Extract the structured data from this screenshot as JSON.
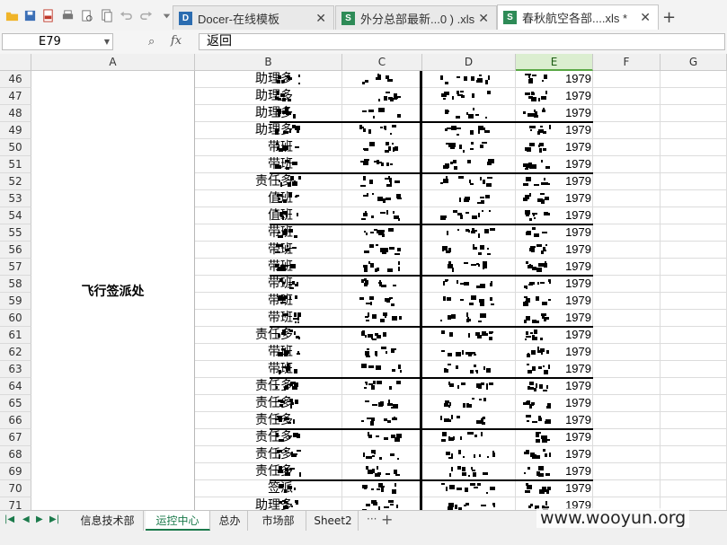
{
  "quick_access": [
    "open-folder-icon",
    "save-icon",
    "pdf-export-icon",
    "print-icon",
    "print-preview-icon",
    "copy-format-icon",
    "undo-icon",
    "redo-icon",
    "dropdown-icon"
  ],
  "tabs": [
    {
      "label": "Docer-在线模板",
      "icon": "D",
      "color": "#2b6cb0",
      "active": false
    },
    {
      "label": "外分总部最新...0 ) .xls",
      "icon": "S",
      "color": "#2e8b57",
      "active": false
    },
    {
      "label": "春秋航空各部....xls *",
      "icon": "S",
      "color": "#2e8b57",
      "active": true
    }
  ],
  "formula_bar": {
    "name_box": "E79",
    "content": "返回"
  },
  "columns": [
    {
      "label": "A"
    },
    {
      "label": "B"
    },
    {
      "label": "C"
    },
    {
      "label": "D"
    },
    {
      "label": "E",
      "selected": true
    },
    {
      "label": "F"
    },
    {
      "label": "G"
    }
  ],
  "merged_a_label": "飞行签派处",
  "rows": [
    {
      "n": "46",
      "b": "助理多",
      "e": "1979"
    },
    {
      "n": "47",
      "b": "助理多",
      "e": "1979"
    },
    {
      "n": "48",
      "b": "助理多",
      "e": "1979"
    },
    {
      "n": "49",
      "b": "助理多",
      "e": "1979"
    },
    {
      "n": "50",
      "b": "带班",
      "e": "1979"
    },
    {
      "n": "51",
      "b": "带班",
      "e": "1979"
    },
    {
      "n": "52",
      "b": "责任多",
      "e": "1979"
    },
    {
      "n": "53",
      "b": "值班",
      "e": "1979"
    },
    {
      "n": "54",
      "b": "值班",
      "e": "1979"
    },
    {
      "n": "55",
      "b": "带班",
      "e": "1979"
    },
    {
      "n": "56",
      "b": "带班",
      "e": "1979"
    },
    {
      "n": "57",
      "b": "带班",
      "e": "1979"
    },
    {
      "n": "58",
      "b": "带班",
      "e": "1979"
    },
    {
      "n": "59",
      "b": "带班",
      "e": "1979"
    },
    {
      "n": "60",
      "b": "带班",
      "e": "1979"
    },
    {
      "n": "61",
      "b": "责任多",
      "e": "1979"
    },
    {
      "n": "62",
      "b": "带班",
      "e": "1979"
    },
    {
      "n": "63",
      "b": "带班",
      "e": "1979"
    },
    {
      "n": "64",
      "b": "责任多",
      "e": "1979"
    },
    {
      "n": "65",
      "b": "责任多",
      "e": "1979"
    },
    {
      "n": "66",
      "b": "责任多",
      "e": "1979"
    },
    {
      "n": "67",
      "b": "责任多",
      "e": "1979"
    },
    {
      "n": "68",
      "b": "责任多",
      "e": "1979"
    },
    {
      "n": "69",
      "b": "责任多",
      "e": "1979"
    },
    {
      "n": "70",
      "b": "签派",
      "e": "1979"
    },
    {
      "n": "71",
      "b": "助理多",
      "e": "1979"
    }
  ],
  "group_breaks_after_rows": [
    "48",
    "51",
    "54",
    "57",
    "60",
    "63",
    "66",
    "69"
  ],
  "sheets": [
    {
      "label": "信息技术部",
      "active": false
    },
    {
      "label": "运控中心",
      "active": true
    },
    {
      "label": "总办",
      "active": false
    },
    {
      "label": "市场部",
      "active": false
    },
    {
      "label": "Sheet2",
      "active": false
    }
  ],
  "sheet_add_label": "+",
  "watermark": "www.wooyun.org"
}
